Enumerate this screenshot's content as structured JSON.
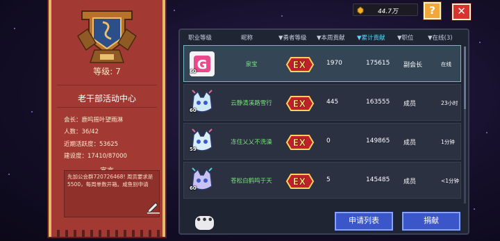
{
  "guild": {
    "level_text": "等级: 7",
    "name": "老干部活动中心",
    "leader": "会长：鹿呜摇叶望雨淋",
    "members": "人数：36/42",
    "activity": "近期活跃度：53625",
    "construction": "建设度：17410/87000",
    "declaration_title": "宣言",
    "declaration": "先加公会群720726468! 周贡要求是5500，每周单数开箱。咸鱼别申请"
  },
  "currency": {
    "value": "44.7万",
    "icon": "gem-coin-icon"
  },
  "buttons": {
    "help": "?",
    "close": "✕",
    "apply_list": "申请列表",
    "donate": "捐献",
    "chat": "•••"
  },
  "columns": {
    "class_level": "职业等级",
    "nickname": "昵称",
    "hero_level": "▼勇者等级",
    "weekly": "▼本周贡献",
    "total": "▼累计贡献",
    "position": "▼职位",
    "online": "▼在线(3)"
  },
  "members": [
    {
      "level": "60",
      "name": "泉宝",
      "badge": "EX",
      "weekly": "1970",
      "total": "175615",
      "position": "副会长",
      "online": "在线",
      "avatar": "pink-g-avatar-icon"
    },
    {
      "level": "60",
      "name": "云静清溪路雪行",
      "badge": "EX",
      "weekly": "445",
      "total": "163555",
      "position": "成员",
      "online": "23小时",
      "avatar": "cat-avatar-icon"
    },
    {
      "level": "59",
      "name": "冻住乂乂不洗澡",
      "badge": "EX",
      "weekly": "0",
      "total": "149865",
      "position": "成员",
      "online": "1分钟",
      "avatar": "cat-avatar-icon"
    },
    {
      "level": "60",
      "name": "苍松白鹤鸣于天",
      "badge": "EX",
      "weekly": "5",
      "total": "145485",
      "position": "成员",
      "online": "<1分钟",
      "avatar": "cat-avatar-icon"
    }
  ],
  "colors": {
    "banner": "#a23a33",
    "panel": "#202534",
    "accent": "#5ad7ff",
    "name_green": "#7be07e"
  }
}
